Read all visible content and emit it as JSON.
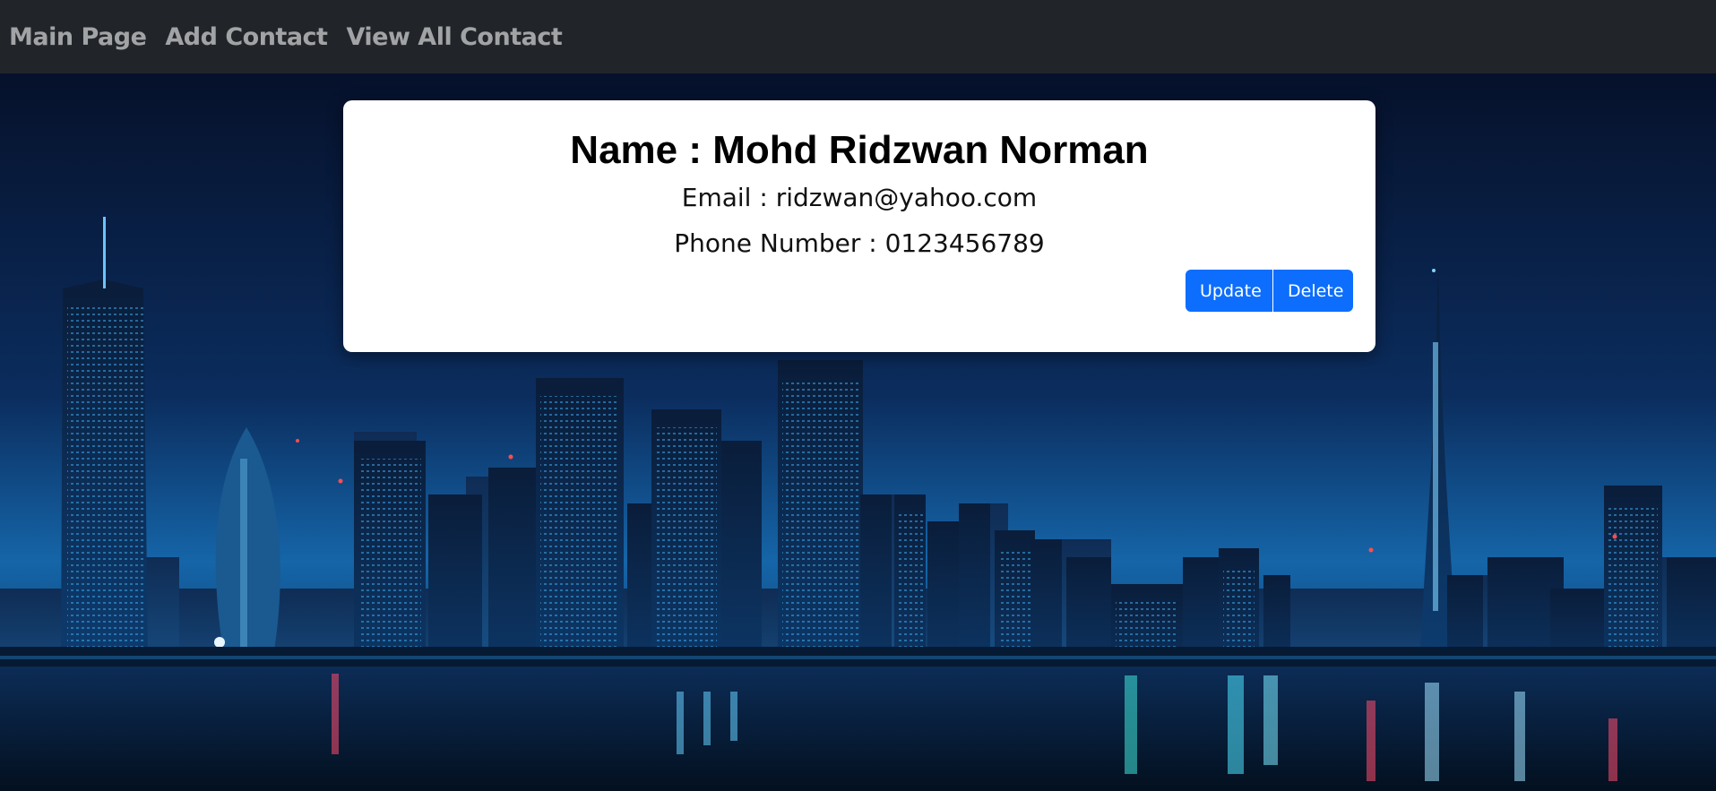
{
  "nav": {
    "items": [
      {
        "label": "Main Page"
      },
      {
        "label": "Add Contact"
      },
      {
        "label": "View All Contact"
      }
    ]
  },
  "contact": {
    "name_label": "Name :",
    "name_value": "Mohd Ridzwan Norman",
    "email_text": "Email : ridzwan@yahoo.com",
    "phone_text": "Phone Number : 0123456789"
  },
  "actions": {
    "update_label": "Update",
    "delete_label": "Delete"
  },
  "colors": {
    "navbar_bg": "#212529",
    "button_primary": "#0d6efd",
    "card_bg": "#ffffff",
    "sky_top": "#050d24",
    "sky_bottom": "#0e3f7a"
  },
  "background": {
    "description_icon": "night-city-skyline-image"
  }
}
